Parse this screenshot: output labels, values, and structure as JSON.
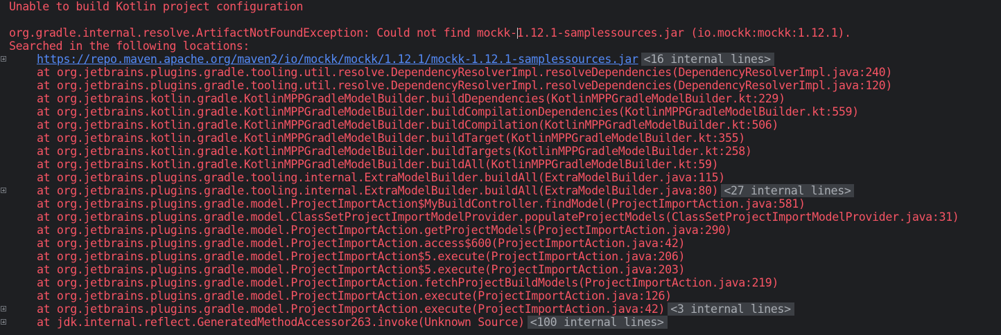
{
  "console": {
    "header": "Unable to build Kotlin project configuration",
    "exception_before_caret": "org.gradle.internal.resolve.ArtifactNotFoundException: Could not find mockk-",
    "exception_after_caret": "1.12.1-samplessources.jar (io.mockk:mockk:1.12.1).",
    "searched": "Searched in the following locations:",
    "location_link": "https://repo.maven.apache.org/maven2/io/mockk/mockk/1.12.1/mockk-1.12.1-samplessources.jar",
    "location_fold": "<16 internal lines>",
    "stack": [
      {
        "text": "at org.jetbrains.plugins.gradle.tooling.util.resolve.DependencyResolverImpl.resolveDependencies(DependencyResolverImpl.java:240)",
        "fold": null
      },
      {
        "text": "at org.jetbrains.plugins.gradle.tooling.util.resolve.DependencyResolverImpl.resolveDependencies(DependencyResolverImpl.java:120)",
        "fold": null
      },
      {
        "text": "at org.jetbrains.kotlin.gradle.KotlinMPPGradleModelBuilder.buildDependencies(KotlinMPPGradleModelBuilder.kt:229)",
        "fold": null
      },
      {
        "text": "at org.jetbrains.kotlin.gradle.KotlinMPPGradleModelBuilder.buildCompilationDependencies(KotlinMPPGradleModelBuilder.kt:559)",
        "fold": null
      },
      {
        "text": "at org.jetbrains.kotlin.gradle.KotlinMPPGradleModelBuilder.buildCompilation(KotlinMPPGradleModelBuilder.kt:506)",
        "fold": null
      },
      {
        "text": "at org.jetbrains.kotlin.gradle.KotlinMPPGradleModelBuilder.buildTarget(KotlinMPPGradleModelBuilder.kt:355)",
        "fold": null
      },
      {
        "text": "at org.jetbrains.kotlin.gradle.KotlinMPPGradleModelBuilder.buildTargets(KotlinMPPGradleModelBuilder.kt:258)",
        "fold": null
      },
      {
        "text": "at org.jetbrains.kotlin.gradle.KotlinMPPGradleModelBuilder.buildAll(KotlinMPPGradleModelBuilder.kt:59)",
        "fold": null
      },
      {
        "text": "at org.jetbrains.plugins.gradle.tooling.internal.ExtraModelBuilder.buildAll(ExtraModelBuilder.java:115)",
        "fold": null
      },
      {
        "text": "at org.jetbrains.plugins.gradle.tooling.internal.ExtraModelBuilder.buildAll(ExtraModelBuilder.java:80)",
        "fold": "<27 internal lines>"
      },
      {
        "text": "at org.jetbrains.plugins.gradle.model.ProjectImportAction$MyBuildController.findModel(ProjectImportAction.java:581)",
        "fold": null
      },
      {
        "text": "at org.jetbrains.plugins.gradle.model.ClassSetProjectImportModelProvider.populateProjectModels(ClassSetProjectImportModelProvider.java:31)",
        "fold": null
      },
      {
        "text": "at org.jetbrains.plugins.gradle.model.ProjectImportAction.getProjectModels(ProjectImportAction.java:290)",
        "fold": null
      },
      {
        "text": "at org.jetbrains.plugins.gradle.model.ProjectImportAction.access$600(ProjectImportAction.java:42)",
        "fold": null
      },
      {
        "text": "at org.jetbrains.plugins.gradle.model.ProjectImportAction$5.execute(ProjectImportAction.java:206)",
        "fold": null
      },
      {
        "text": "at org.jetbrains.plugins.gradle.model.ProjectImportAction$5.execute(ProjectImportAction.java:203)",
        "fold": null
      },
      {
        "text": "at org.jetbrains.plugins.gradle.model.ProjectImportAction.fetchProjectBuildModels(ProjectImportAction.java:219)",
        "fold": null
      },
      {
        "text": "at org.jetbrains.plugins.gradle.model.ProjectImportAction.execute(ProjectImportAction.java:126)",
        "fold": null
      },
      {
        "text": "at org.jetbrains.plugins.gradle.model.ProjectImportAction.execute(ProjectImportAction.java:42)",
        "fold": "<3 internal lines>"
      },
      {
        "text": "at jdk.internal.reflect.GeneratedMethodAccessor263.invoke(Unknown Source)",
        "fold": "<100 internal lines>"
      }
    ]
  },
  "colors": {
    "background": "#1e1f22",
    "error_text": "#f75464",
    "link": "#548af7",
    "fold_label_bg": "#3c3f44",
    "fold_label_text": "#a9adb3"
  },
  "icons": {
    "fold_toggle": "plus-square-icon"
  }
}
